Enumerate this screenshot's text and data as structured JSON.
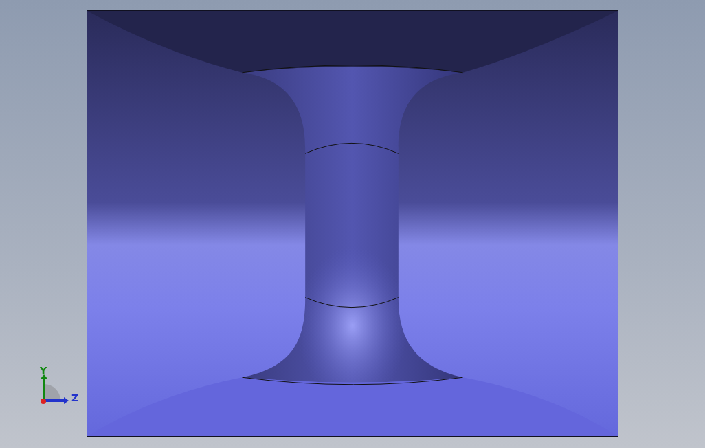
{
  "triad": {
    "axes": [
      {
        "label": "Y",
        "color": "#118811"
      },
      {
        "label": "Z",
        "color": "#2233cc"
      }
    ]
  }
}
